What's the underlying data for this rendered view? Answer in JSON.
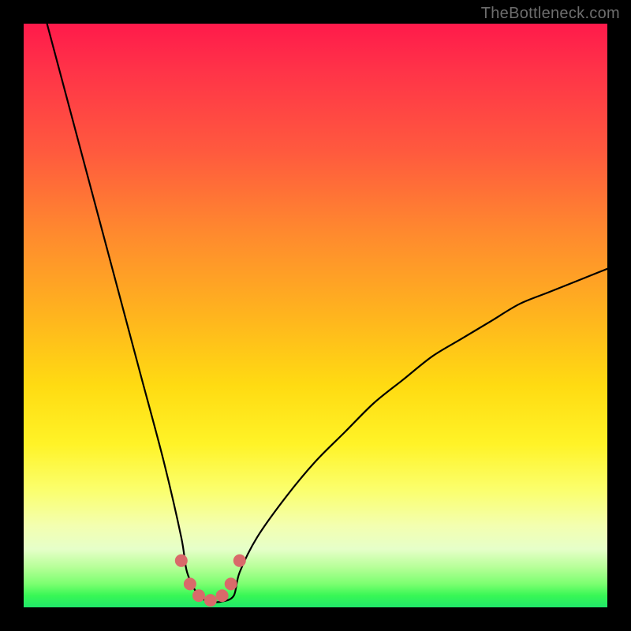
{
  "watermark": {
    "text": "TheBottleneck.com"
  },
  "colors": {
    "curve_stroke": "#000000",
    "marker_fill": "#d96a6a",
    "marker_stroke": "#c65e5e"
  },
  "chart_data": {
    "type": "line",
    "title": "",
    "xlabel": "",
    "ylabel": "",
    "xlim": [
      0,
      100
    ],
    "ylim": [
      0,
      100
    ],
    "grid": false,
    "legend": false,
    "note": "Percent-axes estimate of a bottleneck curve. Minimum (~0%) between x≈28 and x≈36. Left branch rises to ~100% near x≈4; right branch rises to ~58% at x=100.",
    "series": [
      {
        "name": "bottleneck-curve",
        "x": [
          4,
          8,
          12,
          16,
          20,
          24,
          27,
          28,
          30,
          32,
          34,
          36,
          37,
          40,
          45,
          50,
          55,
          60,
          65,
          70,
          75,
          80,
          85,
          90,
          95,
          100
        ],
        "values": [
          100,
          85,
          70,
          55,
          40,
          25,
          12,
          6,
          2,
          1,
          1,
          2,
          6,
          12,
          19,
          25,
          30,
          35,
          39,
          43,
          46,
          49,
          52,
          54,
          56,
          58
        ]
      }
    ],
    "markers": {
      "name": "flat-bottom-dots",
      "x": [
        27,
        28.5,
        30,
        32,
        34,
        35.5,
        37
      ],
      "values": [
        8,
        4,
        2,
        1.2,
        2,
        4,
        8
      ]
    }
  }
}
